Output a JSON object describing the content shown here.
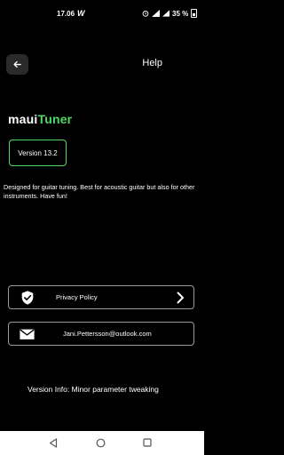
{
  "status_bar": {
    "time": "17.06",
    "app_icon_letter": "W",
    "battery": "35 %"
  },
  "header": {
    "back_icon": "arrow-left-icon",
    "title": "Help"
  },
  "logo": {
    "part1": "maui",
    "part2": "Tuner",
    "accent_color": "#4cd964"
  },
  "version": {
    "label": "Version 13.2"
  },
  "description": "Designed for guitar tuning. Best for acoustic guitar but also for other instruments. Have fun!",
  "privacy": {
    "icon": "shield-check-icon",
    "label": "Privacy Policy",
    "chevron": "chevron-right-icon"
  },
  "email": {
    "icon": "envelope-icon",
    "label": "Jani.Pettersson@outlook.com"
  },
  "version_info": "Version Info: Minor parameter tweaking",
  "nav": {
    "back_icon": "triangle-back-icon",
    "home_icon": "circle-home-icon",
    "recent_icon": "square-recents-icon"
  }
}
